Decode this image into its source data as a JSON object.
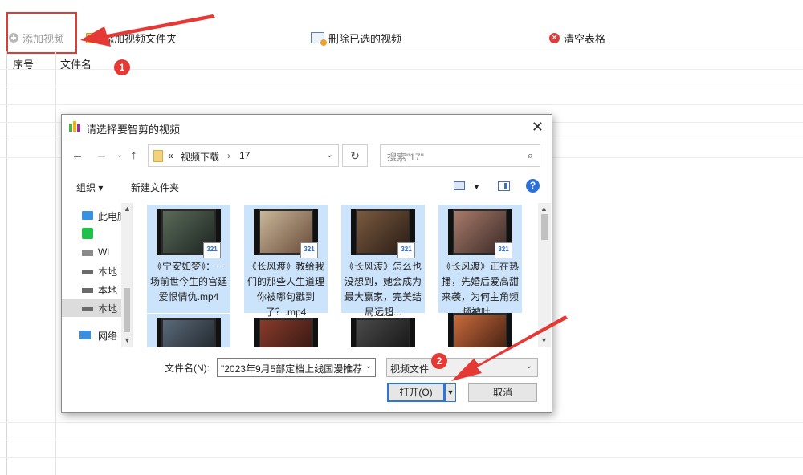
{
  "toolbar": {
    "add_video": "添加视频",
    "add_folder": "添加视频文件夹",
    "delete_selected": "删除已选的视频",
    "clear_table": "清空表格"
  },
  "table": {
    "col_index": "序号",
    "col_filename": "文件名"
  },
  "annotations": {
    "step1": "1",
    "step2": "2",
    "accent": "#e53935"
  },
  "dialog": {
    "title": "请选择要智剪的视频",
    "path": [
      "视频下载",
      "17"
    ],
    "path_prefix": "«",
    "search_placeholder": "搜索\"17\"",
    "organize": "组织 ▾",
    "new_folder": "新建文件夹",
    "sidebar": [
      {
        "label": "此电脑",
        "icon": "computer-icon"
      },
      {
        "label": "",
        "icon": "iqiyi-app-icon"
      },
      {
        "label": "Wi",
        "icon": "windows-drive-icon"
      },
      {
        "label": "本地",
        "icon": "drive-icon"
      },
      {
        "label": "本地",
        "icon": "drive-icon"
      },
      {
        "label": "本地",
        "icon": "drive-icon"
      },
      {
        "label": "网络",
        "icon": "network-icon"
      }
    ],
    "files": [
      {
        "name": "《宁安如梦》：一场前世今生的宫廷爱恨情仇.mp4"
      },
      {
        "name": "《长风渡》教给我们的那些人生道理你被哪句戳到了？.mp4"
      },
      {
        "name": "《长风渡》怎么也没想到，她会成为最大赢家，完美结局远超..."
      },
      {
        "name": "《长风渡》正在热播，先婚后爱高甜来袭，为何主角频频被吐..."
      }
    ],
    "filename_label": "文件名(N):",
    "filename_value": "\"2023年9月5部定档上线国漫推荐",
    "filetype": "视频文件",
    "open": "打开(O)",
    "cancel": "取消"
  }
}
